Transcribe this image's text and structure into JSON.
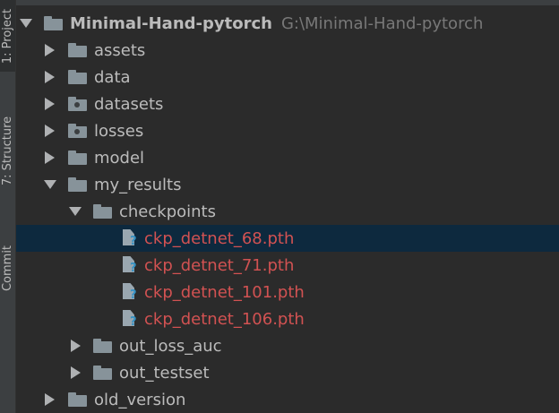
{
  "side_tabs": [
    {
      "label": "1: Project",
      "active": true
    },
    {
      "label": "7: Structure",
      "active": false
    },
    {
      "label": "Commit",
      "active": false
    }
  ],
  "tree": {
    "root": {
      "name": "Minimal-Hand-pytorch",
      "path": "G:\\Minimal-Hand-pytorch"
    },
    "items": [
      {
        "name": "assets"
      },
      {
        "name": "data"
      },
      {
        "name": "datasets"
      },
      {
        "name": "losses"
      },
      {
        "name": "model"
      },
      {
        "name": "my_results"
      },
      {
        "name": "checkpoints"
      },
      {
        "name": "ckp_detnet_68.pth"
      },
      {
        "name": "ckp_detnet_71.pth"
      },
      {
        "name": "ckp_detnet_101.pth"
      },
      {
        "name": "ckp_detnet_106.pth"
      },
      {
        "name": "out_loss_auc"
      },
      {
        "name": "out_testset"
      },
      {
        "name": "old_version"
      }
    ]
  },
  "colors": {
    "background": "#2b2b2b",
    "selection": "#0d293e",
    "untracked_file_text": "#d25252",
    "folder_icon": "#87939a"
  }
}
